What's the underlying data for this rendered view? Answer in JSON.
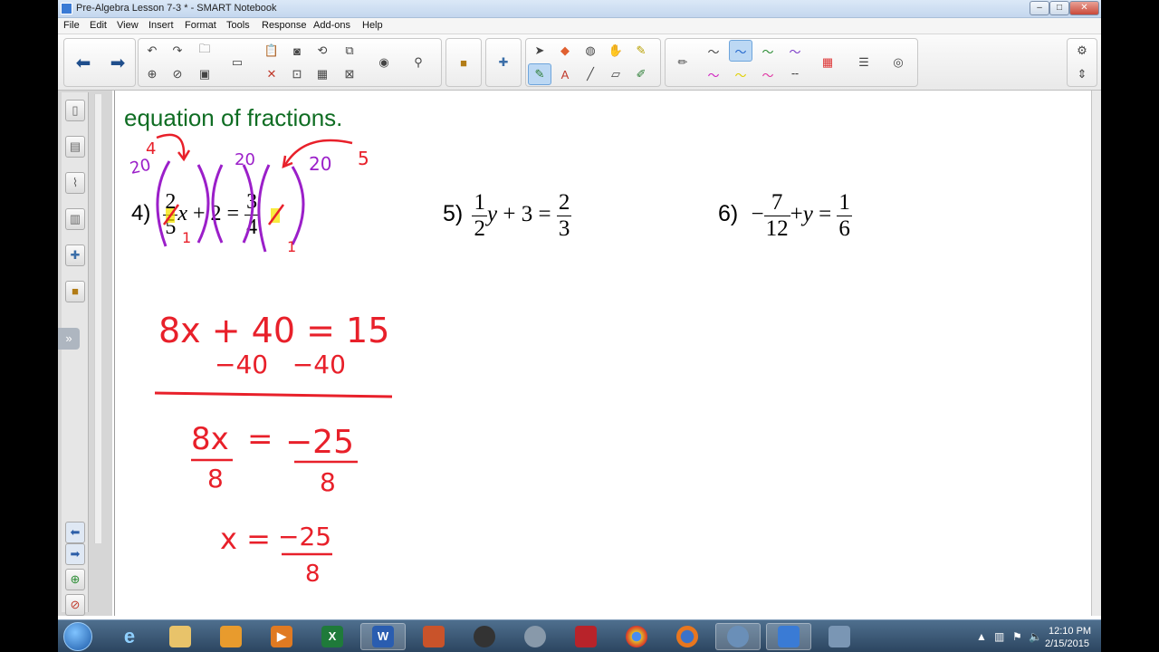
{
  "window": {
    "title": "Pre-Algebra Lesson 7-3 * - SMART Notebook",
    "min": "–",
    "max": "□",
    "close": "✕"
  },
  "menu": [
    "File",
    "Edit",
    "View",
    "Insert",
    "Format",
    "Tools",
    "Response",
    "Add-ons",
    "Help"
  ],
  "toolbar": {
    "back_icon": "arrow-left-icon",
    "forward_icon": "arrow-right-icon",
    "settings_icon": "gear-icon",
    "move_icon": "move-toolbar-icon"
  },
  "sidebar": {
    "tabs": [
      "page-sorter-icon",
      "gallery-icon",
      "attachments-icon",
      "properties-icon",
      "add-ons-icon",
      "lesson-activity-icon"
    ],
    "expand": "»"
  },
  "content": {
    "heading": "equation of fractions.",
    "problem4_label": "4)",
    "problem4": {
      "frac1_num": "2",
      "frac1_den": "5",
      "var": "x",
      "op": "+",
      "const": "2",
      "eq": "=",
      "frac2_num": "3",
      "frac2_den": "4"
    },
    "problem5_label": "5)",
    "problem5": {
      "frac1_num": "1",
      "frac1_den": "2",
      "var": "y",
      "op": "+",
      "const": "3",
      "eq": "=",
      "frac2_num": "2",
      "frac2_den": "3"
    },
    "problem6_label": "6)",
    "problem6": {
      "sign": "−",
      "frac1_num": "7",
      "frac1_den": "12",
      "op": "+",
      "var": "y",
      "eq": "=",
      "frac2_num": "1",
      "frac2_den": "6"
    }
  },
  "annotations": {
    "multiplier_left": "20",
    "multiplier_mid": "20",
    "multiplier_right": "20",
    "cross_4": "4",
    "cross_5": "5",
    "cancel_1a": "1",
    "cancel_1b": "1",
    "work_line1": "8x + 40 = 15",
    "work_line2": "−40   −40",
    "work_line3_left": "8x",
    "work_line3_eq": "=",
    "work_line3_right": "−25",
    "work_line3_den_left": "8",
    "work_line3_den_right": "8",
    "work_line4_left": "x =",
    "work_line4_num": "−25",
    "work_line4_den": "8",
    "ink_red": "#e8202a",
    "ink_purple": "#9b1fc9",
    "ink_yellow": "#f5e400"
  },
  "taskbar": {
    "apps": [
      "internet-explorer-icon",
      "file-explorer-icon",
      "outlook-icon",
      "media-player-icon",
      "excel-icon",
      "word-icon",
      "powerpoint-icon",
      "hp-icon",
      "network-icon",
      "chrome-like-icon",
      "chrome-icon",
      "firefox-icon",
      "screen-capture-icon",
      "smart-notebook-icon",
      "smart-tools-icon"
    ],
    "app_letters": {
      "excel": "X",
      "word": "W"
    },
    "time": "12:10 PM",
    "date": "2/15/2015"
  }
}
